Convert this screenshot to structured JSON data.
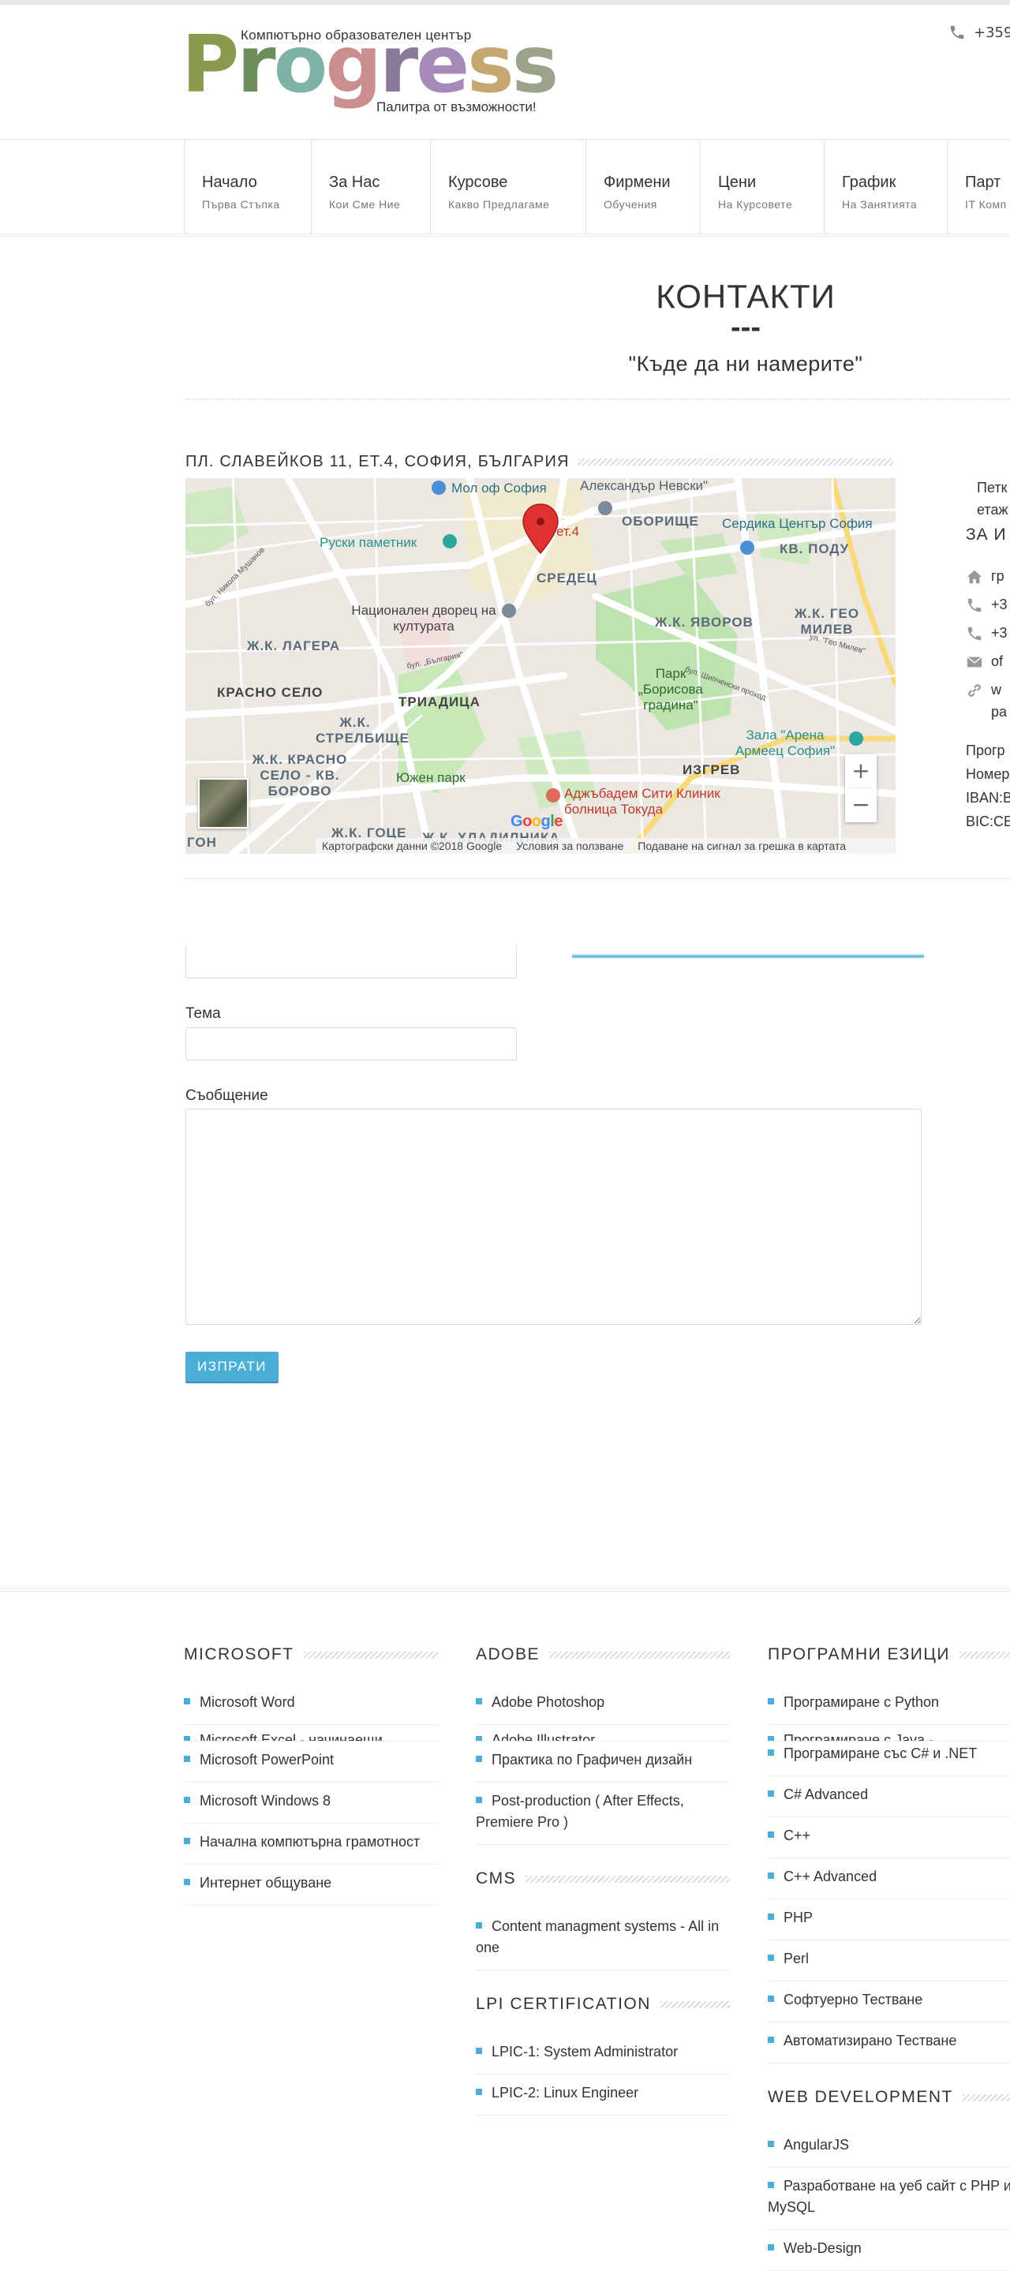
{
  "header": {
    "logo_top": "Компютърно образователен център",
    "logo_word_letters": [
      "P",
      "r",
      "o",
      "g",
      "r",
      "e",
      "s",
      "s"
    ],
    "logo_tagline": "Палитра от възможности!",
    "phone": "+359"
  },
  "nav": [
    {
      "title": "Начало",
      "sub": "Първа Стъпка"
    },
    {
      "title": "За Нас",
      "sub": "Кои Сме Ние"
    },
    {
      "title": "Курсове",
      "sub": "Какво Предлагаме"
    },
    {
      "title": "Фирмени",
      "sub": "Обучения"
    },
    {
      "title": "Цени",
      "sub": "На Курсовете"
    },
    {
      "title": "График",
      "sub": "На Занятията"
    },
    {
      "title": "Парт",
      "sub": "IT Комп"
    }
  ],
  "page": {
    "title": "КОНТАКТИ",
    "dash": "---",
    "subtitle": "\"Къде да ни намерите\""
  },
  "address_heading": "ПЛ. СЛАВЕЙКОВ 11, ЕТ.4, СОФИЯ, БЪЛГАРИЯ",
  "map": {
    "labels": {
      "mall": "Мол оф София",
      "nevski": "Александър Невски\"",
      "oborishte": "ОБОРИЩЕ",
      "serdika": "Сердика Център София",
      "kv_podu": "КВ. ПОДУ",
      "ruski": "Руски паметник",
      "sredets": "СРЕДЕЦ",
      "ndk": "Национален дворец на културата",
      "yavorov": "Ж.К. ЯВОРОВ",
      "geo_milev": "Ж.К. ГЕО МИЛЕВ",
      "lagera": "Ж.К. ЛАГЕРА",
      "park_borisova": "Парк „Борисова градина\"",
      "krasno_selo": "КРАСНО СЕЛО",
      "triaditsa": "ТРИАДИЦА",
      "strelbishte": "Ж.К. СТРЕЛБИЩЕ",
      "arena": "Зала \"Арена Армеец София\"",
      "krasno_borovo": "Ж.К. КРАСНО СЕЛО - КВ. БОРОВО",
      "yuzhen": "Южен парк",
      "izgrev": "ИЗГРЕВ",
      "tokuda": "Аджъбадем Сити Клиник болница Токуда",
      "et4": "ет.4",
      "goce": "Ж.К. ГОЦЕ",
      "hladilnika": "Ж.К. ХЛАДИЛНИКА",
      "gon": "ГОН",
      "str_mushanov": "бул. Никола Мушанов",
      "str_bulgaria": "бул. „България\"",
      "str_geo": "ул. \"Гео Милев\"",
      "str_shipchenski": "бул. Шипченски проход"
    },
    "zoom_in": "+",
    "zoom_out": "−",
    "google": [
      "G",
      "o",
      "o",
      "g",
      "l",
      "e"
    ],
    "footer": [
      "Картографски данни ©2018 Google",
      "Условия за ползване",
      "Подаване на сигнал за грешка в картата"
    ]
  },
  "info": {
    "addr_lines": [
      "Петк",
      "етаж"
    ],
    "heading": "ЗА И",
    "rows": [
      {
        "icon": "home-icon",
        "text": "гр"
      },
      {
        "icon": "phone-icon",
        "text": "+3"
      },
      {
        "icon": "phone-icon",
        "text": "+3"
      },
      {
        "icon": "mail-icon",
        "text": "of"
      },
      {
        "icon": "link-icon",
        "text": "w"
      }
    ],
    "row_extra": "ра",
    "bank": [
      "Прогр",
      "Номер",
      "IBAN:B",
      "BIC:CE"
    ]
  },
  "form": {
    "subject_label": "Тема",
    "message_label": "Съобщение",
    "send": "ИЗПРАТИ"
  },
  "footer": {
    "col1": {
      "heading": "MICROSOFT",
      "items": [
        "Microsoft Word",
        "Microsoft Excel - начинаещи",
        "Microsoft PowerPoint",
        "Microsoft Windows 8",
        "Начална компютърна грамотност",
        "Интернет общуване"
      ]
    },
    "col2": {
      "heading": "ADOBE",
      "items": [
        "Adobe Photoshop",
        "Adobe Illustrator",
        "Практика по Графичен дизайн",
        "Post-production ( After Effects, Premiere Pro )"
      ],
      "cms_heading": "CMS",
      "cms_items": [
        "Content managment systems - All in one"
      ],
      "lpi_heading": "LPI CERTIFICATION",
      "lpi_items": [
        "LPIC-1: System Administrator",
        "LPIC-2: Linux Engineer"
      ]
    },
    "col3": {
      "heading": "ПРОГРАМНИ ЕЗИЦИ",
      "items": [
        "Програмиране с Python",
        "Програмиране с Java -",
        "Програмиране със C# и .NET",
        "C# Advanced",
        "C++",
        "C++ Advanced",
        "PHP",
        "Perl",
        "Софтуерно Тестване",
        "Автоматизирано Тестване"
      ],
      "web_heading": "WEB DEVELOPMENT",
      "web_items": [
        "AngularJS",
        "Разработване на уеб сайт с PHP и MySQL",
        "Web-Design"
      ]
    }
  },
  "colors": {
    "accent": "#4aaed7",
    "logo_letters": [
      "#8a9a4e",
      "#6b8e5a",
      "#7fb3a8",
      "#c98e8e",
      "#8a7a9a",
      "#a58ab8",
      "#c4a870",
      "#9ba48a"
    ]
  }
}
